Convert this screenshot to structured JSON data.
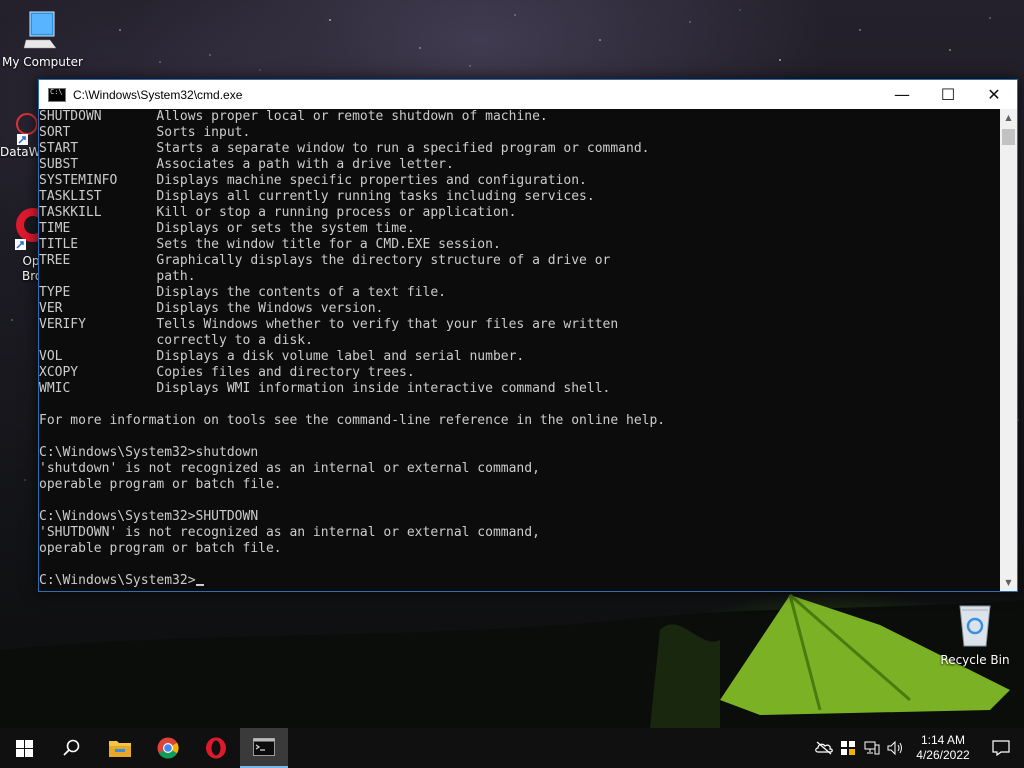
{
  "desktop": {
    "icons": [
      {
        "label": "My Computer"
      },
      {
        "label": "DataW"
      },
      {
        "label": "Op\nBrov"
      },
      {
        "label": "Recycle Bin"
      }
    ]
  },
  "window": {
    "title": "C:\\Windows\\System32\\cmd.exe",
    "controls": {
      "minimize": "—",
      "maximize": "☐",
      "close": "✕"
    }
  },
  "console": {
    "lines": [
      "SHUTDOWN       Allows proper local or remote shutdown of machine.",
      "SORT           Sorts input.",
      "START          Starts a separate window to run a specified program or command.",
      "SUBST          Associates a path with a drive letter.",
      "SYSTEMINFO     Displays machine specific properties and configuration.",
      "TASKLIST       Displays all currently running tasks including services.",
      "TASKKILL       Kill or stop a running process or application.",
      "TIME           Displays or sets the system time.",
      "TITLE          Sets the window title for a CMD.EXE session.",
      "TREE           Graphically displays the directory structure of a drive or",
      "               path.",
      "TYPE           Displays the contents of a text file.",
      "VER            Displays the Windows version.",
      "VERIFY         Tells Windows whether to verify that your files are written",
      "               correctly to a disk.",
      "VOL            Displays a disk volume label and serial number.",
      "XCOPY          Copies files and directory trees.",
      "WMIC           Displays WMI information inside interactive command shell.",
      "",
      "For more information on tools see the command-line reference in the online help.",
      "",
      "C:\\Windows\\System32>shutdown",
      "'shutdown' is not recognized as an internal or external command,",
      "operable program or batch file.",
      "",
      "C:\\Windows\\System32>SHUTDOWN",
      "'SHUTDOWN' is not recognized as an internal or external command,",
      "operable program or batch file.",
      ""
    ],
    "prompt": "C:\\Windows\\System32>"
  },
  "taskbar": {
    "clock_time": "1:14 AM",
    "clock_date": "4/26/2022"
  },
  "colors": {
    "console_bg": "#0c0c0c",
    "console_fg": "#cccccc",
    "taskbar_bg": "#101010",
    "accent": "#76b9ed"
  }
}
